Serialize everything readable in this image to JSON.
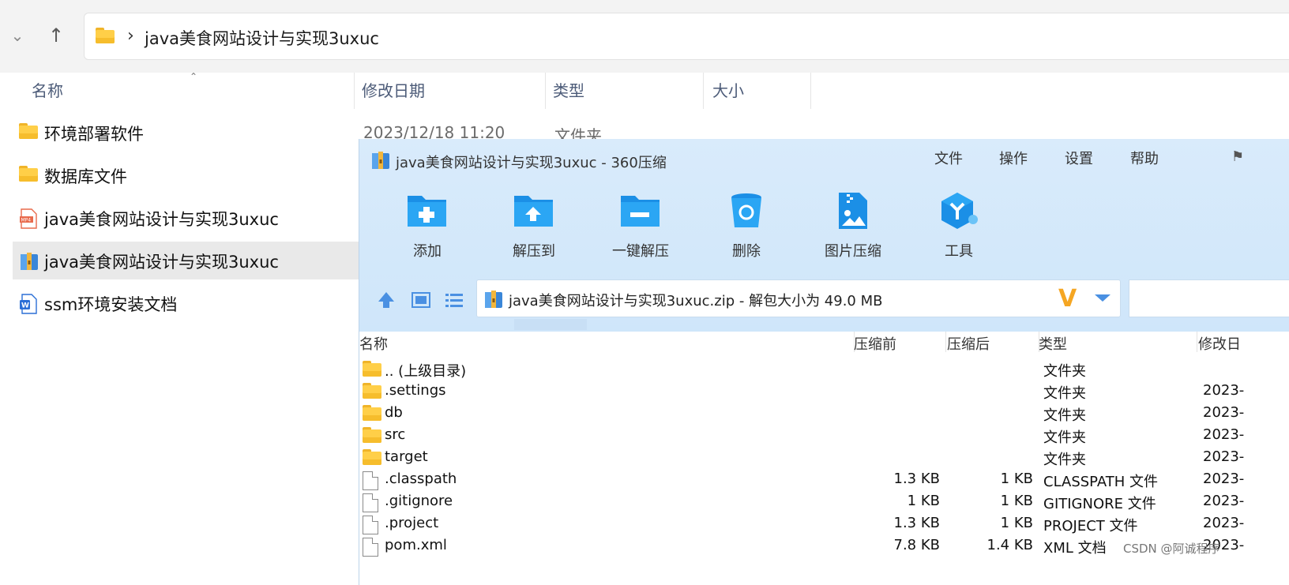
{
  "explorer": {
    "address_path": "java美食网站设计与实现3uxuc",
    "columns": {
      "name": "名称",
      "modified": "修改日期",
      "type": "类型",
      "size": "大小"
    },
    "items": [
      {
        "name": "环境部署软件",
        "icon": "folder-icon",
        "date": "2023/12/18 11:20",
        "type": "文件夹"
      },
      {
        "name": "数据库文件",
        "icon": "folder-icon"
      },
      {
        "name": "java美食网站设计与实现3uxuc",
        "icon": "mp4-file-icon"
      },
      {
        "name": "java美食网站设计与实现3uxuc",
        "icon": "zip-archive-icon",
        "selected": true
      },
      {
        "name": "ssm环境安装文档",
        "icon": "word-doc-icon"
      }
    ]
  },
  "zip": {
    "title": "java美食网站设计与实现3uxuc - 360压缩",
    "menu": [
      "文件",
      "操作",
      "设置",
      "帮助"
    ],
    "toolbar": [
      {
        "label": "添加",
        "icon": "add-folder-icon"
      },
      {
        "label": "解压到",
        "icon": "extract-to-icon"
      },
      {
        "label": "一键解压",
        "icon": "one-click-extract-icon"
      },
      {
        "label": "删除",
        "icon": "delete-bin-icon"
      },
      {
        "label": "图片压缩",
        "icon": "image-compress-icon"
      },
      {
        "label": "工具",
        "icon": "tools-icon"
      }
    ],
    "path_text": "java美食网站设计与实现3uxuc.zip - 解包大小为 49.0 MB",
    "columns": {
      "name": "名称",
      "before": "压缩前",
      "after": "压缩后",
      "type": "类型",
      "modified": "修改日"
    },
    "rows": [
      {
        "name": ".. (上级目录)",
        "icon": "folder-icon",
        "before": "",
        "after": "",
        "type": "文件夹",
        "date": ""
      },
      {
        "name": ".settings",
        "icon": "folder-icon",
        "before": "",
        "after": "",
        "type": "文件夹",
        "date": "2023-"
      },
      {
        "name": "db",
        "icon": "folder-icon",
        "before": "",
        "after": "",
        "type": "文件夹",
        "date": "2023-"
      },
      {
        "name": "src",
        "icon": "folder-icon",
        "before": "",
        "after": "",
        "type": "文件夹",
        "date": "2023-"
      },
      {
        "name": "target",
        "icon": "folder-icon",
        "before": "",
        "after": "",
        "type": "文件夹",
        "date": "2023-"
      },
      {
        "name": ".classpath",
        "icon": "file-icon",
        "before": "1.3 KB",
        "after": "1 KB",
        "type": "CLASSPATH 文件",
        "date": "2023-"
      },
      {
        "name": ".gitignore",
        "icon": "file-icon",
        "before": "1 KB",
        "after": "1 KB",
        "type": "GITIGNORE 文件",
        "date": "2023-"
      },
      {
        "name": ".project",
        "icon": "file-icon",
        "before": "1.3 KB",
        "after": "1 KB",
        "type": "PROJECT 文件",
        "date": "2023-"
      },
      {
        "name": "pom.xml",
        "icon": "file-icon",
        "before": "7.8 KB",
        "after": "1.4 KB",
        "type": "XML 文档",
        "date": "2023-"
      }
    ]
  },
  "watermark": "CSDN @阿诚程序"
}
